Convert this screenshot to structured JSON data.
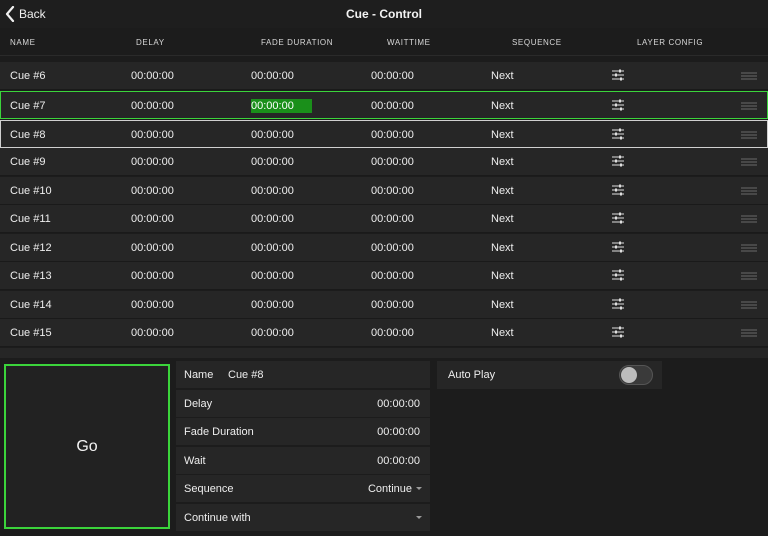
{
  "header": {
    "back_label": "Back",
    "title": "Cue - Control"
  },
  "columns": [
    "NAME",
    "DELAY",
    "FADE DURATION",
    "WAITTIME",
    "SEQUENCE",
    "LAYER CONFIG"
  ],
  "rows": [
    {
      "name": "Cue #6",
      "delay": "00:00:00",
      "fade": "00:00:00",
      "wait": "00:00:00",
      "sequence": "Next"
    },
    {
      "name": "Cue #7",
      "delay": "00:00:00",
      "fade": "00:00:00",
      "wait": "00:00:00",
      "sequence": "Next"
    },
    {
      "name": "Cue #8",
      "delay": "00:00:00",
      "fade": "00:00:00",
      "wait": "00:00:00",
      "sequence": "Next"
    },
    {
      "name": "Cue #9",
      "delay": "00:00:00",
      "fade": "00:00:00",
      "wait": "00:00:00",
      "sequence": "Next"
    },
    {
      "name": "Cue #10",
      "delay": "00:00:00",
      "fade": "00:00:00",
      "wait": "00:00:00",
      "sequence": "Next"
    },
    {
      "name": "Cue #11",
      "delay": "00:00:00",
      "fade": "00:00:00",
      "wait": "00:00:00",
      "sequence": "Next"
    },
    {
      "name": "Cue #12",
      "delay": "00:00:00",
      "fade": "00:00:00",
      "wait": "00:00:00",
      "sequence": "Next"
    },
    {
      "name": "Cue #13",
      "delay": "00:00:00",
      "fade": "00:00:00",
      "wait": "00:00:00",
      "sequence": "Next"
    },
    {
      "name": "Cue #14",
      "delay": "00:00:00",
      "fade": "00:00:00",
      "wait": "00:00:00",
      "sequence": "Next"
    },
    {
      "name": "Cue #15",
      "delay": "00:00:00",
      "fade": "00:00:00",
      "wait": "00:00:00",
      "sequence": "Next"
    }
  ],
  "go_label": "Go",
  "details": {
    "name_label": "Name",
    "name_value": "Cue #8",
    "delay_label": "Delay",
    "delay_value": "00:00:00",
    "fade_label": "Fade Duration",
    "fade_value": "00:00:00",
    "wait_label": "Wait",
    "wait_value": "00:00:00",
    "sequence_label": "Sequence",
    "sequence_value": "Continue",
    "continue_label": "Continue with",
    "continue_value": ""
  },
  "autoplay": {
    "label": "Auto Play",
    "enabled": false
  },
  "colors": {
    "accent": "#3bd43b",
    "highlight": "#1a8f1a",
    "row_bg": "#262626",
    "bg": "#1c1c1c"
  }
}
